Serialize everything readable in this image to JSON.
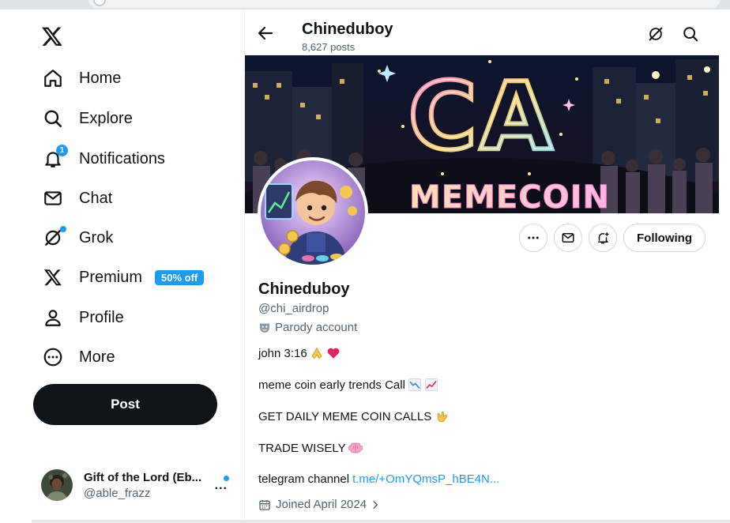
{
  "sidebar": {
    "logo_icon": "x-logo-icon",
    "nav": [
      {
        "label": "Home",
        "icon": "home-icon"
      },
      {
        "label": "Explore",
        "icon": "search-icon"
      },
      {
        "label": "Notifications",
        "icon": "bell-icon",
        "badge": "1"
      },
      {
        "label": "Chat",
        "icon": "envelope-icon"
      },
      {
        "label": "Grok",
        "icon": "grok-icon"
      },
      {
        "label": "Premium",
        "icon": "x-logo-icon",
        "promo": "50% off"
      },
      {
        "label": "Profile",
        "icon": "person-icon"
      },
      {
        "label": "More",
        "icon": "more-circle-icon"
      }
    ],
    "post_label": "Post",
    "account": {
      "name": "Gift of the Lord (Eb...",
      "handle": "@able_frazz",
      "more": "..."
    }
  },
  "profile": {
    "header_name": "Chineduboy",
    "post_count": "8,627 posts",
    "name": "Chineduboy",
    "handle": "@chi_airdrop",
    "parody_label": "Parody account",
    "bio": [
      "john 3:16",
      "meme coin early trends Call",
      "GET DAILY MEME COIN CALLS",
      "TRADE WISELY",
      "telegram channel"
    ],
    "telegram_link": "t.me/+OmYQmsP_hBE4N...",
    "joined": "Joined April 2024",
    "following_label": "Following",
    "banner_text_top": "CA",
    "banner_text_bottom": "MEMECOIN"
  },
  "colors": {
    "accent": "#1d9bf0",
    "text": "#0f1419",
    "muted": "#536471",
    "border": "#cfd9de"
  }
}
